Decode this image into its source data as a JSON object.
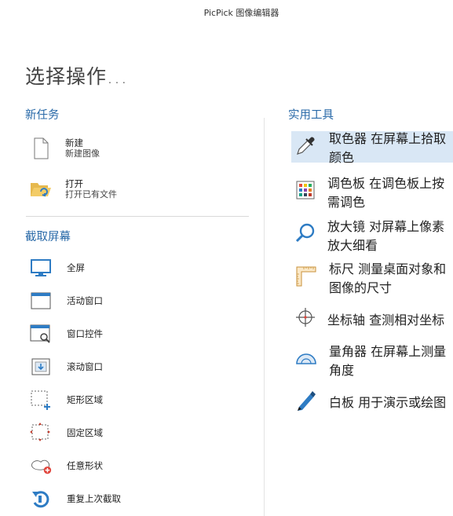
{
  "window": {
    "title": "PicPick 图像编辑器"
  },
  "heading": "选择操作...",
  "new_task": {
    "title": "新任务",
    "items": [
      {
        "label": "新建",
        "desc": "新建图像",
        "icon": "new-file-icon"
      },
      {
        "label": "打开",
        "desc": "打开已有文件",
        "icon": "open-folder-icon"
      }
    ]
  },
  "capture": {
    "title": "截取屏幕",
    "items": [
      {
        "label": "全屏",
        "icon": "monitor-icon"
      },
      {
        "label": "活动窗口",
        "icon": "window-icon"
      },
      {
        "label": "窗口控件",
        "icon": "window-control-icon"
      },
      {
        "label": "滚动窗口",
        "icon": "scroll-window-icon"
      },
      {
        "label": "矩形区域",
        "icon": "rect-region-icon"
      },
      {
        "label": "固定区域",
        "icon": "fixed-region-icon"
      },
      {
        "label": "任意形状",
        "icon": "freehand-shape-icon"
      },
      {
        "label": "重复上次截取",
        "icon": "repeat-capture-icon"
      }
    ]
  },
  "tools": {
    "title": "实用工具",
    "items": [
      {
        "label": "取色器",
        "desc": "在屏幕上拾取颜色",
        "icon": "eyedropper-icon",
        "selected": true
      },
      {
        "label": "调色板",
        "desc": "在调色板上按需调色",
        "icon": "palette-icon"
      },
      {
        "label": "放大镜",
        "desc": "对屏幕上像素放大细看",
        "icon": "magnifier-icon"
      },
      {
        "label": "标尺",
        "desc": "测量桌面对象和图像的尺寸",
        "icon": "ruler-icon"
      },
      {
        "label": "坐标轴",
        "desc": "查测相对坐标",
        "icon": "crosshair-icon"
      },
      {
        "label": "量角器",
        "desc": "在屏幕上测量角度",
        "icon": "protractor-icon"
      },
      {
        "label": "白板",
        "desc": "用于演示或绘图",
        "icon": "pen-icon"
      }
    ]
  },
  "colors": {
    "accent": "#2a6aa8",
    "highlight": "#d9e7f5",
    "icon_blue": "#2e7cc4"
  }
}
